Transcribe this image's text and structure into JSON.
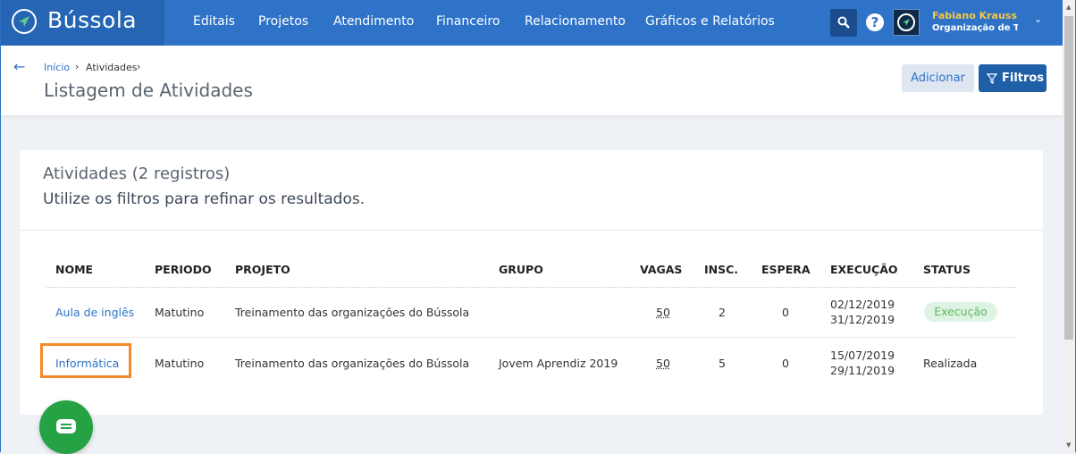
{
  "app": {
    "logo_text": "Bússola"
  },
  "nav": {
    "items": [
      "Editais",
      "Projetos",
      "Atendimento",
      "Financeiro",
      "Relacionamento",
      "Gráficos e Relatórios"
    ]
  },
  "user": {
    "name": "Fabiano Krauss",
    "org": "Organização de Treinamento",
    "help_label": "?"
  },
  "breadcrumb": {
    "home": "Início",
    "current": "Atividades",
    "separator": "›"
  },
  "page": {
    "title": "Listagem de Atividades"
  },
  "actions": {
    "add_label": "Adicionar",
    "filter_label": "Filtros"
  },
  "card": {
    "title": "Atividades (2 registros)",
    "subtitle": "Utilize os filtros para refinar os resultados."
  },
  "table": {
    "columns": [
      "NOME",
      "PERIODO",
      "PROJETO",
      "GRUPO",
      "VAGAS",
      "INSC.",
      "ESPERA",
      "EXECUÇÃO",
      "STATUS"
    ],
    "rows": [
      {
        "nome": "Aula de inglês",
        "periodo": "Matutino",
        "projeto": "Treinamento das organizações do Bússola",
        "grupo": "",
        "vagas": "50",
        "insc": "2",
        "espera": "0",
        "exec_inicio": "02/12/2019",
        "exec_fim": "31/12/2019",
        "status": "Execução"
      },
      {
        "nome": "Informática",
        "periodo": "Matutino",
        "projeto": "Treinamento das organizações do Bússola",
        "grupo": "Jovem Aprendiz 2019",
        "vagas": "50",
        "insc": "5",
        "espera": "0",
        "exec_inicio": "15/07/2019",
        "exec_fim": "29/11/2019",
        "status": "Realizada"
      }
    ]
  },
  "colors": {
    "primary": "#2f73c8",
    "highlight": "#f58a2a",
    "success": "#25a244"
  }
}
